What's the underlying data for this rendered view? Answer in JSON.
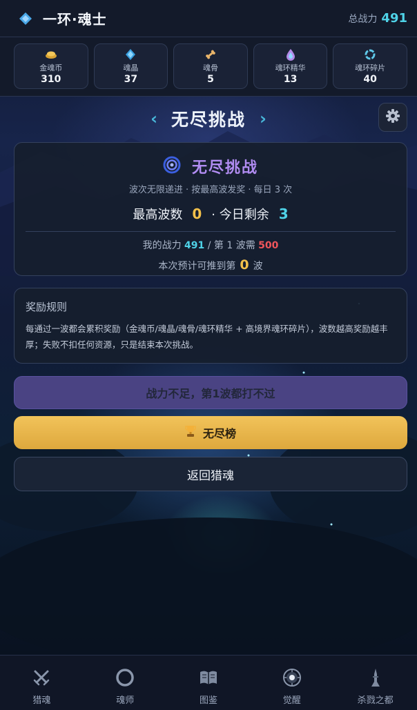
{
  "header": {
    "title": "一环·魂士",
    "power_label": "总战力",
    "power_value": "491"
  },
  "resources": [
    {
      "name": "金魂币",
      "count": "310",
      "icon": "gold-coin-icon"
    },
    {
      "name": "魂晶",
      "count": "37",
      "icon": "crystal-icon"
    },
    {
      "name": "魂骨",
      "count": "5",
      "icon": "bone-icon"
    },
    {
      "name": "魂环精华",
      "count": "13",
      "icon": "essence-drop-icon"
    },
    {
      "name": "魂环碎片",
      "count": "40",
      "icon": "ring-fragment-icon"
    }
  ],
  "page": {
    "title": "无尽挑战",
    "prev": "‹",
    "next": "›"
  },
  "challenge": {
    "title": "无尽挑战",
    "subtitle": "波次无限递进 · 按最高波发奖 · 每日 3 次",
    "best_wave_label": "最高波数",
    "best_wave_value": "0",
    "today_label": "· 今日剩余",
    "today_value": "3",
    "my_power_label": "我的战力",
    "my_power_value": "491",
    "wave_need_label": "/ 第 1 波需",
    "wave_need_value": "500",
    "predict_prefix": "本次预计可推到第",
    "predict_value": "0",
    "predict_suffix": "波"
  },
  "rules": {
    "title": "奖励规则",
    "body": "每通过一波都会累积奖励（金魂币/魂晶/魂骨/魂环精华 + 高境界魂环碎片），波数越高奖励越丰厚；失败不扣任何资源，只是结束本次挑战。"
  },
  "buttons": {
    "fight": "战力不足，第1波都打不过",
    "rank": "无尽榜",
    "back": "返回猎魂"
  },
  "nav": [
    {
      "label": "猎魂",
      "icon": "crossed-swords-icon"
    },
    {
      "label": "魂师",
      "icon": "ring-icon"
    },
    {
      "label": "图鉴",
      "icon": "book-icon"
    },
    {
      "label": "觉醒",
      "icon": "awaken-icon"
    },
    {
      "label": "杀戮之都",
      "icon": "tower-icon"
    }
  ],
  "colors": {
    "accent_cyan": "#4fd3e8",
    "accent_gold": "#f2c04a",
    "accent_red": "#f0555b",
    "accent_purple": "#b18cf2"
  }
}
